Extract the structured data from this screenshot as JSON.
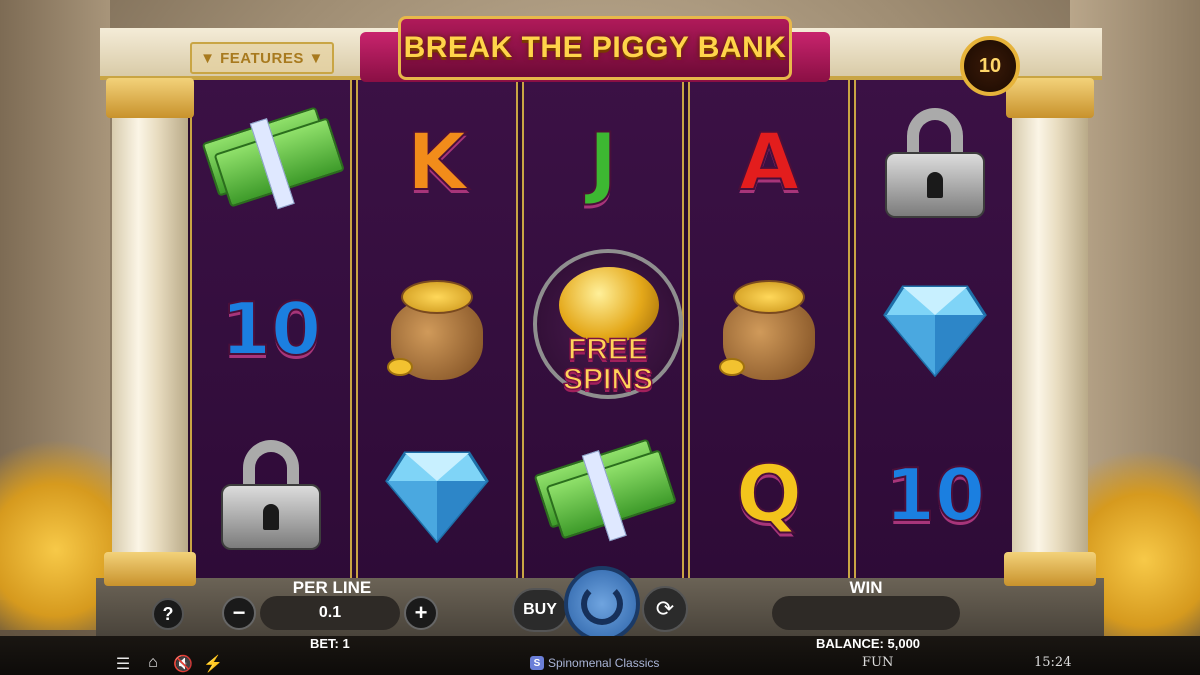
{
  "title": "BREAK THE PIGGY BANK",
  "features_label": "▼ FEATURES ▼",
  "level_badge": "10",
  "reels": [
    {
      "symbols": [
        {
          "type": "cash",
          "name": "cash-stack-icon"
        },
        {
          "type": "letter",
          "text": "10",
          "cls": "l-10"
        },
        {
          "type": "lock",
          "name": "padlock-icon"
        }
      ]
    },
    {
      "symbols": [
        {
          "type": "letter",
          "text": "K",
          "cls": "l-k"
        },
        {
          "type": "bag",
          "name": "coin-sack-icon"
        },
        {
          "type": "gem",
          "name": "diamond-icon"
        }
      ]
    },
    {
      "symbols": [
        {
          "type": "letter",
          "text": "J",
          "cls": "l-j"
        },
        {
          "type": "piggy",
          "text": "FREE\nSPINS"
        },
        {
          "type": "cash",
          "name": "cash-stack-icon"
        }
      ]
    },
    {
      "symbols": [
        {
          "type": "letter",
          "text": "A",
          "cls": "l-a"
        },
        {
          "type": "bag",
          "name": "coin-sack-icon"
        },
        {
          "type": "letter",
          "text": "Q",
          "cls": "l-q"
        }
      ]
    },
    {
      "symbols": [
        {
          "type": "lock",
          "name": "padlock-icon"
        },
        {
          "type": "gem",
          "name": "diamond-icon"
        },
        {
          "type": "letter",
          "text": "10",
          "cls": "l-10"
        }
      ]
    }
  ],
  "controls": {
    "help_label": "?",
    "perline_label": "PER LINE",
    "minus_label": "−",
    "plus_label": "+",
    "perline_value": "0.1",
    "buy_label": "BUY",
    "auto_label": "⟳",
    "win_label": "WIN",
    "win_value": ""
  },
  "info": {
    "bet": "BET: 1",
    "balance": "BALANCE: 5,000",
    "provider": "Spinomenal Classics",
    "provider_logo": "S",
    "mode": "FUN",
    "clock": "15:24",
    "icons": {
      "menu": "☰",
      "home": "⌂",
      "sound": "🔇",
      "turbo": "⚡"
    }
  }
}
